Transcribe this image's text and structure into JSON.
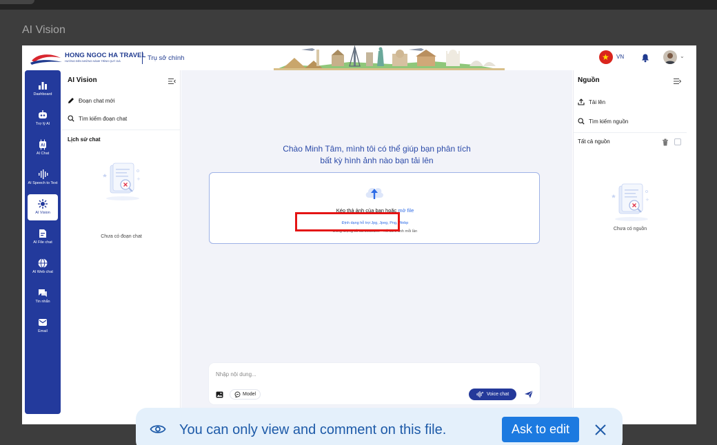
{
  "outer": {
    "title": "AI Vision"
  },
  "header": {
    "brand_name": "HONG NGOC HA TRAVEL",
    "brand_tagline": "HƯỚNG ĐẾN NHỮNG HÀNH TRÌNH QUÝ GIÁ",
    "branch": "Trụ sở chính",
    "language": "VN"
  },
  "sidebar": {
    "items": [
      {
        "label": "Dashboard",
        "icon": "bar-chart-icon"
      },
      {
        "label": "Trợ lý AI",
        "icon": "robot-icon"
      },
      {
        "label": "AI Chat",
        "icon": "ai-chip-icon"
      },
      {
        "label": "AI Speech to Text",
        "icon": "waveform-icon"
      },
      {
        "label": "AI Vision",
        "icon": "vision-icon",
        "active": true
      },
      {
        "label": "AI File chat",
        "icon": "file-chat-icon"
      },
      {
        "label": "AI Web chat",
        "icon": "globe-icon"
      },
      {
        "label": "Tin nhắn",
        "icon": "messages-icon"
      },
      {
        "label": "Email",
        "icon": "mail-icon"
      }
    ]
  },
  "left_panel": {
    "title": "AI Vision",
    "new_chat": "Đoạn chat mới",
    "search_chat": "Tìm kiếm đoạn chat",
    "history_title": "Lịch sử chat",
    "empty_text": "Chưa có đoạn chat"
  },
  "main": {
    "greeting_line1": "Chào Minh Tâm, mình tôi có thể giúp bạn phân tích",
    "greeting_line2": "bất kỳ hình ảnh nào bạn tải lên",
    "drop_text": "Kéo thả ảnh của bạn hoặc",
    "drop_link": "mở file",
    "formats": "Định dạng hỗ trợ:Jpg, Jpeg, Png, Webp",
    "limit": "Dung lượng tối đa 5MB/ảnh - Tối đa 5 ảnh mỗi lần",
    "composer_placeholder": "Nhập nội dung...",
    "model_label": "Model",
    "voice_label": "Voice chat"
  },
  "right_panel": {
    "title": "Nguồn",
    "upload": "Tải lên",
    "search": "Tìm kiếm nguồn",
    "all_sources": "Tất cả nguồn",
    "empty_text": "Chưa có nguồn"
  },
  "toast": {
    "message": "You can only view and comment on this file.",
    "action": "Ask to edit"
  },
  "colors": {
    "sidebar": "#233a9c",
    "accent": "#2b4aa8",
    "link": "#2d6be6",
    "highlight": "#e41414",
    "toast_bg": "#e4f0fb",
    "toast_button": "#1c7ae0"
  }
}
